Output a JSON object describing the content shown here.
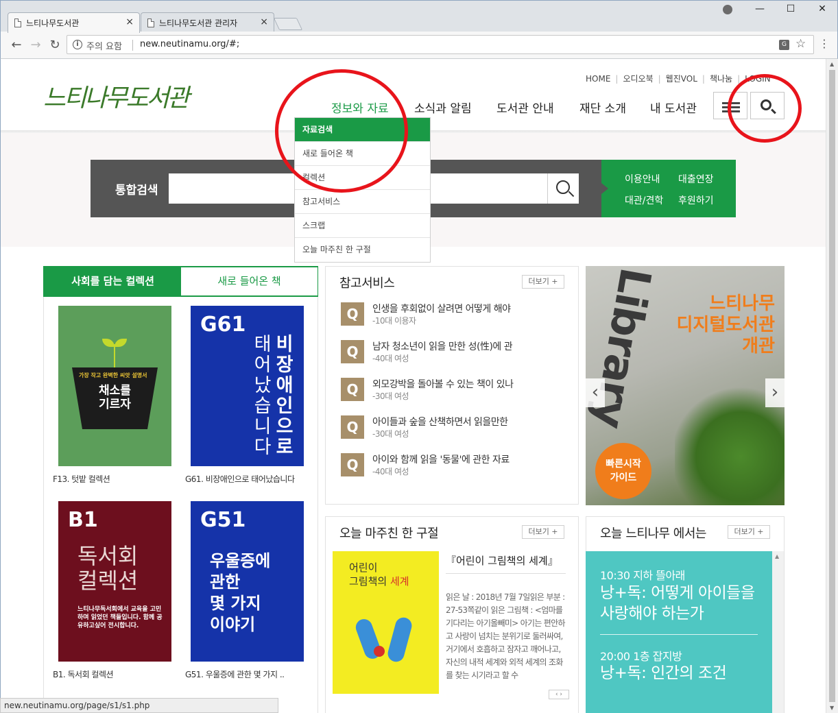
{
  "browser": {
    "tabs": [
      {
        "title": "느티나무도서관",
        "close": "×"
      },
      {
        "title": "느티나무도서관 관리자",
        "close": "×"
      }
    ],
    "window_controls": {
      "minimize": "—",
      "maximize": "☐",
      "close": "✕"
    },
    "nav": {
      "back": "←",
      "forward": "→",
      "reload": "↻"
    },
    "security_label": "주의 요함",
    "url": "new.neutinamu.org/#;",
    "status_url": "new.neutinamu.org/page/s1/s1.php"
  },
  "site": {
    "logo": "느티나무도서관",
    "util_links": [
      "HOME",
      "오디오북",
      "웹진VOL",
      "책나눔",
      "LOGIN"
    ],
    "gnb": [
      "정보와 자료",
      "소식과 알림",
      "도서관 안내",
      "재단 소개",
      "내 도서관"
    ],
    "dropdown": [
      "자료검색",
      "새로 들어온 책",
      "컬렉션",
      "참고서비스",
      "스크랩",
      "오늘 마주친 한 구절"
    ],
    "search": {
      "label": "통합검색",
      "placeholder": ""
    },
    "quick_links": [
      "이용안내",
      "대출연장",
      "대관/견학",
      "후원하기"
    ]
  },
  "collections": {
    "tabs": [
      "사회를 담는 컬렉션",
      "새로 들어온 책"
    ],
    "books": [
      {
        "cover_code": "",
        "cover_small": "가장 작고 완벽한 씨앗 설명서",
        "cover_title": "채소를\n기르자",
        "caption": "F13. 텃밭 컬렉션"
      },
      {
        "cover_code": "G61",
        "cover_col1": "태어났습니다",
        "cover_col2": "비장애인으로",
        "caption": "G61. 비장애인으로 태어났습니다"
      },
      {
        "cover_code": "B1",
        "cover_title": "독서회\n컬렉션",
        "cover_desc": "느티나무독서회에서 교육을 고민하며 읽었던 책들입니다. 함께 공유하고싶어 전시합니다.",
        "caption": "B1. 독서회 컬렉션"
      },
      {
        "cover_code": "G51",
        "cover_title": "우울증에\n관한\n몇 가지\n이야기",
        "caption": "G51. 우울증에 관한 몇 가지 .."
      }
    ]
  },
  "reference": {
    "title": "참고서비스",
    "more": "더보기 +",
    "items": [
      {
        "badge": "Q",
        "title": "인생을 후회없이 살려면 어떻게 해야",
        "meta": "-10대 이용자"
      },
      {
        "badge": "Q",
        "title": "남자 청소년이 읽을 만한 성(性)에 관",
        "meta": "-40대 여성"
      },
      {
        "badge": "Q",
        "title": "외모강박을 돌아볼 수 있는 책이 있나",
        "meta": "-30대 여성"
      },
      {
        "badge": "Q",
        "title": "아이들과 숲을 산책하면서 읽을만한",
        "meta": "-30대 여성"
      },
      {
        "badge": "Q",
        "title": "아이와 함께 읽을 '동물'에 관한 자료",
        "meta": "-40대 여성"
      }
    ]
  },
  "banner": {
    "headline": [
      "느티나무",
      "디지털도서관",
      "개관"
    ],
    "badge": [
      "빠른시작",
      "가이드"
    ],
    "prev": "‹",
    "next": "›"
  },
  "quote": {
    "title": "오늘 마주친 한 구절",
    "more": "더보기 +",
    "cover_line1": "어린이",
    "cover_line2a": "그림책의 ",
    "cover_line2b": "세계",
    "book_title": "『어린이 그림책의 세계』",
    "body": "읽은 날 : 2018년 7월 7일읽은 부분 : 27-53쪽같이 읽은 그림책 : <엄마를 기다리는 아기올빼미> 아기는 편안하고 사랑이 넘치는 분위기로 둘러싸여, 거기에서 호흡하고 잠자고 깨어나고, 자신의 내적 세계와 외적 세계의 조화를 찾는 시기라고 할 수",
    "nav": "‹ ›"
  },
  "today": {
    "title": "오늘 느티나무 에서는",
    "more": "더보기 +",
    "events": [
      {
        "time": "10:30 지하 뜰아래",
        "title": "낭+독: 어떻게 아이들을 사랑해야 하는가"
      },
      {
        "time": "20:00 1층 잡지방",
        "title": "낭+독: 인간의 조건"
      }
    ]
  },
  "colors": {
    "brand_green": "#1a9a46",
    "search_gray": "#555555",
    "accent_orange": "#f07d1b",
    "today_teal": "#4fc7c2",
    "annotation_red": "#e8141b"
  }
}
